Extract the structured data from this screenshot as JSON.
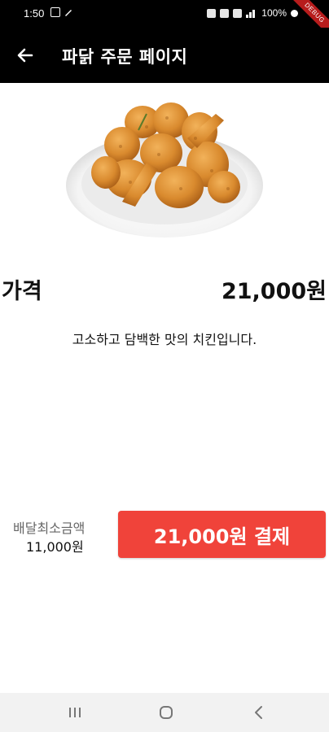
{
  "status_bar": {
    "time": "1:50",
    "battery": "100%",
    "debug_banner": "DEBUG"
  },
  "app_bar": {
    "title": "파닭 주문 페이지",
    "back_icon": "arrow-left-icon"
  },
  "product": {
    "image": "fried-chicken-plate",
    "price_label": "가격",
    "price_value": "21,000원",
    "description": "고소하고 담백한 맛의 치킨입니다."
  },
  "order": {
    "min_delivery_label": "배달최소금액",
    "min_delivery_value": "11,000원",
    "pay_button_label": "21,000원 결제",
    "pay_button_color": "#f0433a"
  },
  "nav_bar": {
    "recents_icon": "recents-icon",
    "home_icon": "home-icon",
    "back_icon": "back-chevron-icon"
  }
}
